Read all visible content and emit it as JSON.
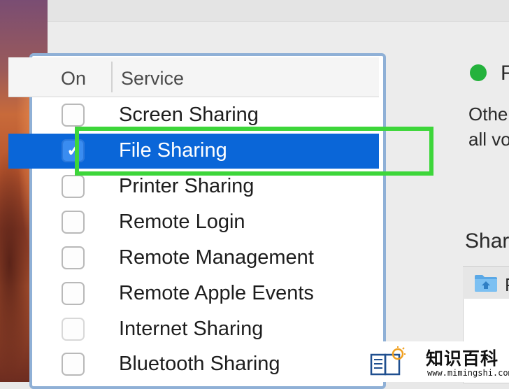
{
  "list": {
    "header_on": "On",
    "header_service": "Service",
    "services": [
      {
        "label": "Screen Sharing",
        "checked": false,
        "selected": false
      },
      {
        "label": "File Sharing",
        "checked": true,
        "selected": true
      },
      {
        "label": "Printer Sharing",
        "checked": false,
        "selected": false
      },
      {
        "label": "Remote Login",
        "checked": false,
        "selected": false
      },
      {
        "label": "Remote Management",
        "checked": false,
        "selected": false
      },
      {
        "label": "Remote Apple Events",
        "checked": false,
        "selected": false
      },
      {
        "label": "Internet Sharing",
        "checked": false,
        "selected": false
      },
      {
        "label": "Bluetooth Sharing",
        "checked": false,
        "selected": false
      }
    ],
    "check_glyph": "✓"
  },
  "detail": {
    "status_text": "F",
    "info_lines": [
      "Othe",
      "all vo"
    ],
    "shared_folders_title": "Shar",
    "shared_folder_name": "P"
  },
  "watermark": {
    "title": "知识百科",
    "url": "www.mimingshi.com"
  },
  "colors": {
    "selection": "#0a66d8",
    "highlight": "#3dd63a",
    "status": "#24b23c",
    "list_border": "#8fb0d6"
  }
}
